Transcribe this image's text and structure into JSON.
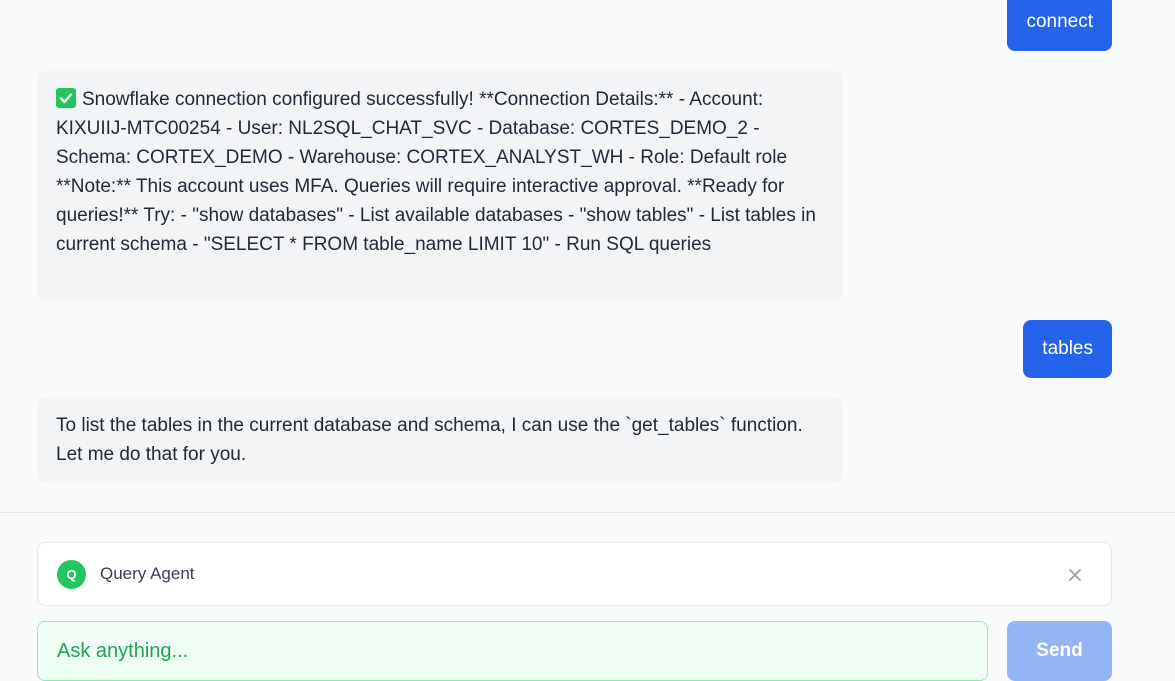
{
  "messages": [
    {
      "role": "user",
      "text": "connect"
    },
    {
      "role": "assistant",
      "text": "Snowflake connection configured successfully! **Connection Details:** - Account: KIXUIIJ-MTC00254 - User: NL2SQL_CHAT_SVC - Database: CORTES_DEMO_2 - Schema: CORTEX_DEMO - Warehouse: CORTEX_ANALYST_WH - Role: Default role **Note:** This account uses MFA. Queries will require interactive approval. **Ready for queries!** Try: - \"show databases\" - List available databases - \"show tables\" - List tables in current schema - \"SELECT * FROM table_name LIMIT 10\" - Run SQL queries",
      "icon": "check-mark-icon"
    },
    {
      "role": "user",
      "text": "tables"
    },
    {
      "role": "assistant",
      "text": "To list the tables in the current database and schema, I can use the `get_tables` function. Let me do that for you."
    }
  ],
  "agent": {
    "avatar_letter": "Q",
    "name": "Query Agent",
    "close_icon": "close-icon"
  },
  "composer": {
    "placeholder": "Ask anything...",
    "value": "",
    "send_label": "Send"
  },
  "colors": {
    "accent": "#2563eb",
    "send_disabled": "#93b4f5",
    "agent_green": "#22c55e",
    "input_border": "#86efac"
  }
}
